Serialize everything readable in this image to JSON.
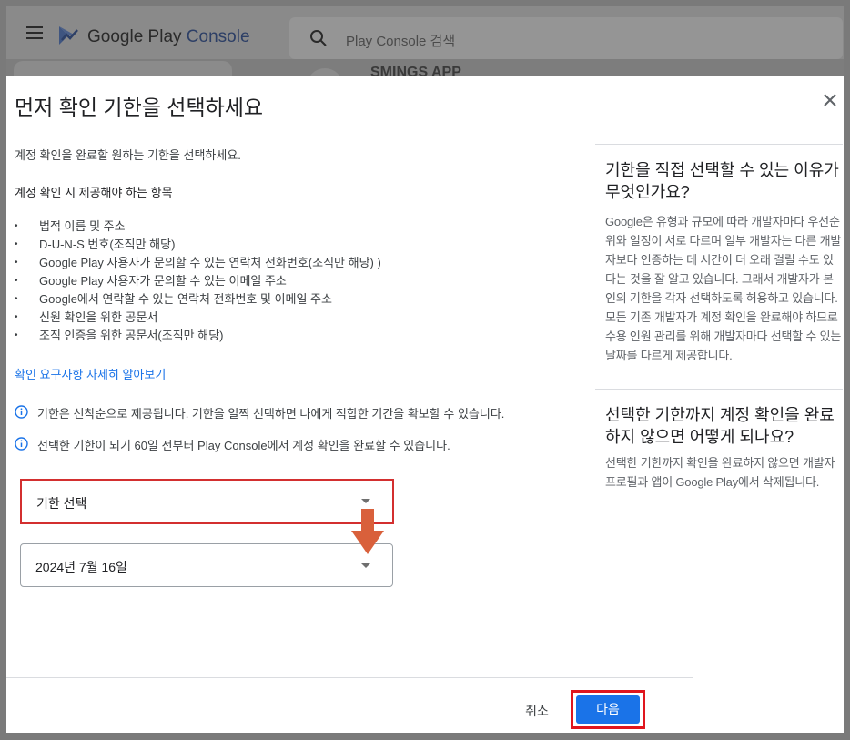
{
  "app": {
    "logo_text": "Google Play",
    "logo_text_suffix": "Console",
    "search_placeholder": "Play Console 검색",
    "background_app_title": "SMINGS APP"
  },
  "dialog": {
    "title": "먼저 확인 기한을 선택하세요",
    "intro": "계정 확인을 완료할 원하는 기한을 선택하세요.",
    "requirements_heading": "계정 확인 시 제공해야 하는 항목",
    "requirements": [
      "법적 이름 및 주소",
      "D-U-N-S 번호(조직만 해당)",
      "Google Play 사용자가 문의할 수 있는 연락처 전화번호(조직만 해당) )",
      "Google Play 사용자가 문의할 수 있는 이메일 주소",
      "Google에서 연락할 수 있는 연락처 전화번호 및 이메일 주소",
      "신원 확인을 위한 공문서",
      "조직 인증을 위한 공문서(조직만 해당)"
    ],
    "learn_more_link": "확인 요구사항 자세히 알아보기",
    "info_1": "기한은 선착순으로 제공됩니다. 기한을 일찍 선택하면 나에게 적합한 기간을 확보할 수 있습니다.",
    "info_2": "선택한 기한이 되기 60일 전부터 Play Console에서 계정 확인을 완료할 수 있습니다.",
    "deadline_select_label": "기한 선택",
    "deadline_select_value": "2024년 7월 16일",
    "cancel_label": "취소",
    "next_label": "다음"
  },
  "faq": [
    {
      "question": "기한을 직접 선택할 수 있는 이유가 무엇인가요?",
      "answer": "Google은 유형과 규모에 따라 개발자마다 우선순위와 일정이 서로 다르며 일부 개발자는 다른 개발자보다 인증하는 데 시간이 더 오래 걸릴 수도 있다는 것을 잘 알고 있습니다. 그래서 개발자가 본인의 기한을 각자 선택하도록 허용하고 있습니다. 모든 기존 개발자가 계정 확인을 완료해야 하므로 수용 인원 관리를 위해 개발자마다 선택할 수 있는 날짜를 다르게 제공합니다."
    },
    {
      "question": "선택한 기한까지 계정 확인을 완료하지 않으면 어떻게 되나요?",
      "answer": "선택한 기한까지 확인을 완료하지 않으면 개발자 프로필과 앱이 Google Play에서 삭제됩니다."
    }
  ],
  "colors": {
    "primary": "#1a73e8",
    "highlight_box": "#e0161e",
    "annotation_arrow": "#d9603b"
  }
}
